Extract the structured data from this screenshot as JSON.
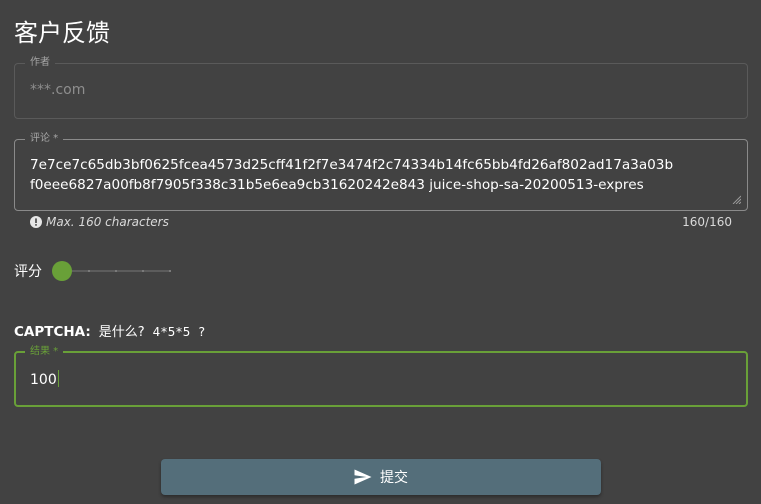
{
  "page": {
    "title": "客户反馈"
  },
  "author": {
    "label": "作者",
    "value": "***.com"
  },
  "comment": {
    "label": "评论 *",
    "value": "7e7ce7c65db3bf0625fcea4573d25cff41f2f7e3474f2c74334b14fc65bb4fd26af802ad17a3a03b\nf0eee6827a00fb8f7905f338c31b5e6ea9cb31620242e843  juice-shop-sa-20200513-expres",
    "hint": "Max. 160 characters",
    "counter": "160/160",
    "hint_icon": "info-icon"
  },
  "rating": {
    "label": "评分",
    "value": 1,
    "min": 1,
    "max": 5,
    "accent_color": "#69a038"
  },
  "captcha": {
    "label": "CAPTCHA:",
    "question": "是什么?",
    "expression": "4*5*5 ?"
  },
  "result": {
    "label": "结果 *",
    "value": "100",
    "accent_color": "#69a038"
  },
  "submit": {
    "label": "提交",
    "icon": "send-icon",
    "color": "#546e7a"
  }
}
